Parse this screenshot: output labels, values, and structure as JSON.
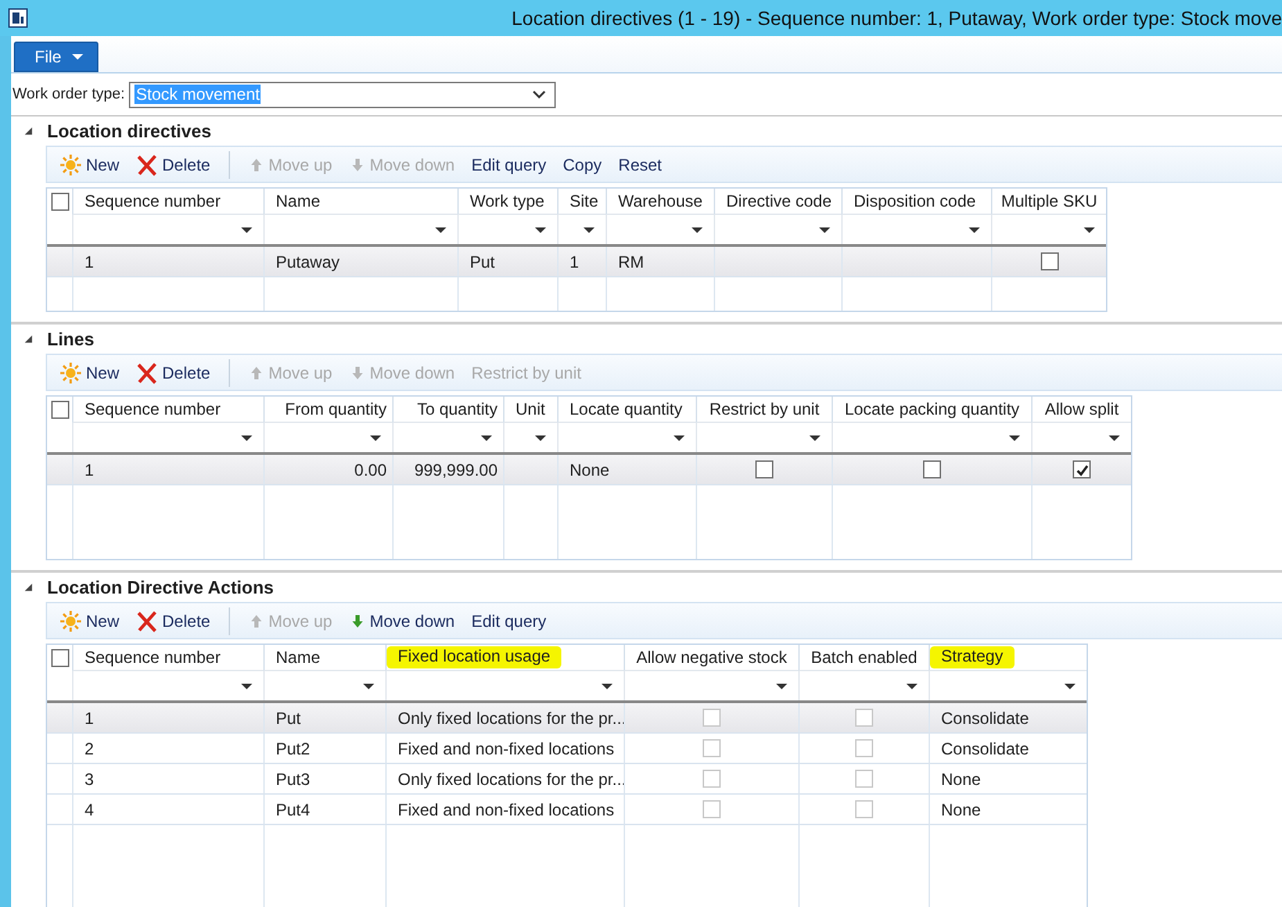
{
  "window": {
    "title": "Location directives (1 - 19) - Sequence number: 1, Putaway, Work order type: Stock move"
  },
  "file_menu": {
    "label": "File"
  },
  "filter": {
    "label": "Work order type:",
    "value": "Stock movement"
  },
  "sections": [
    {
      "title": "Location directives",
      "expanded": true,
      "all_selected": false,
      "toolbar": [
        {
          "label": "New",
          "kind": "new",
          "disabled": false
        },
        {
          "label": "Delete",
          "kind": "delete",
          "disabled": false
        },
        {
          "label": "Move up",
          "kind": "up",
          "disabled": true
        },
        {
          "label": "Move down",
          "kind": "down",
          "disabled": true
        },
        {
          "label": "Edit query",
          "kind": "plain",
          "disabled": false
        },
        {
          "label": "Copy",
          "kind": "plain",
          "disabled": false
        },
        {
          "label": "Reset",
          "kind": "plain",
          "disabled": false
        }
      ],
      "columns": [
        {
          "label": "Sequence number",
          "kind": "text",
          "highlighted": false
        },
        {
          "label": "Name",
          "kind": "text",
          "highlighted": false
        },
        {
          "label": "Work type",
          "kind": "text",
          "highlighted": false
        },
        {
          "label": "Site",
          "kind": "text",
          "highlighted": false
        },
        {
          "label": "Warehouse",
          "kind": "text",
          "highlighted": false
        },
        {
          "label": "Directive code",
          "kind": "text",
          "highlighted": false
        },
        {
          "label": "Disposition code",
          "kind": "text",
          "highlighted": false
        },
        {
          "label": "Multiple SKU",
          "kind": "check",
          "highlighted": false
        }
      ],
      "rows": [
        {
          "selected": true,
          "cells": [
            "1",
            "Putaway",
            "Put",
            "1",
            "RM",
            "",
            "",
            {
              "checked": false,
              "disabled": false
            }
          ]
        }
      ]
    },
    {
      "title": "Lines",
      "expanded": true,
      "all_selected": false,
      "toolbar": [
        {
          "label": "New",
          "kind": "new",
          "disabled": false
        },
        {
          "label": "Delete",
          "kind": "delete",
          "disabled": false
        },
        {
          "label": "Move up",
          "kind": "up",
          "disabled": true
        },
        {
          "label": "Move down",
          "kind": "down",
          "disabled": true
        },
        {
          "label": "Restrict by unit",
          "kind": "plain",
          "disabled": true
        }
      ],
      "columns": [
        {
          "label": "Sequence number",
          "kind": "text",
          "highlighted": false
        },
        {
          "label": "From quantity",
          "kind": "number",
          "highlighted": false
        },
        {
          "label": "To quantity",
          "kind": "number",
          "highlighted": false
        },
        {
          "label": "Unit",
          "kind": "text",
          "highlighted": false
        },
        {
          "label": "Locate quantity",
          "kind": "text",
          "highlighted": false
        },
        {
          "label": "Restrict by unit",
          "kind": "check",
          "highlighted": false
        },
        {
          "label": "Locate packing quantity",
          "kind": "check",
          "highlighted": false
        },
        {
          "label": "Allow split",
          "kind": "check",
          "highlighted": false
        }
      ],
      "rows": [
        {
          "selected": true,
          "cells": [
            "1",
            "0.00",
            "999,999.00",
            "",
            "None",
            {
              "checked": false,
              "disabled": false
            },
            {
              "checked": false,
              "disabled": false
            },
            {
              "checked": true,
              "disabled": false
            }
          ]
        }
      ]
    },
    {
      "title": "Location Directive Actions",
      "expanded": true,
      "all_selected": false,
      "toolbar": [
        {
          "label": "New",
          "kind": "new",
          "disabled": false
        },
        {
          "label": "Delete",
          "kind": "delete",
          "disabled": false
        },
        {
          "label": "Move up",
          "kind": "up",
          "disabled": true
        },
        {
          "label": "Move down",
          "kind": "down",
          "disabled": false
        },
        {
          "label": "Edit query",
          "kind": "plain",
          "disabled": false
        }
      ],
      "columns": [
        {
          "label": "Sequence number",
          "kind": "text",
          "highlighted": false
        },
        {
          "label": "Name",
          "kind": "text",
          "highlighted": false
        },
        {
          "label": "Fixed location usage",
          "kind": "text",
          "highlighted": true
        },
        {
          "label": "Allow negative stock",
          "kind": "check",
          "highlighted": false
        },
        {
          "label": "Batch enabled",
          "kind": "check",
          "highlighted": false
        },
        {
          "label": "Strategy",
          "kind": "text",
          "highlighted": true
        }
      ],
      "rows": [
        {
          "selected": true,
          "cells": [
            "1",
            "Put",
            "Only fixed locations for the pr...",
            {
              "checked": false,
              "disabled": true
            },
            {
              "checked": false,
              "disabled": true
            },
            "Consolidate"
          ]
        },
        {
          "selected": false,
          "cells": [
            "2",
            "Put2",
            "Fixed and non-fixed locations",
            {
              "checked": false,
              "disabled": true
            },
            {
              "checked": false,
              "disabled": true
            },
            "Consolidate"
          ]
        },
        {
          "selected": false,
          "cells": [
            "3",
            "Put3",
            "Only fixed locations for the pr...",
            {
              "checked": false,
              "disabled": true
            },
            {
              "checked": false,
              "disabled": true
            },
            "None"
          ]
        },
        {
          "selected": false,
          "cells": [
            "4",
            "Put4",
            "Fixed and non-fixed locations",
            {
              "checked": false,
              "disabled": true
            },
            {
              "checked": false,
              "disabled": true
            },
            "None"
          ]
        }
      ]
    }
  ]
}
